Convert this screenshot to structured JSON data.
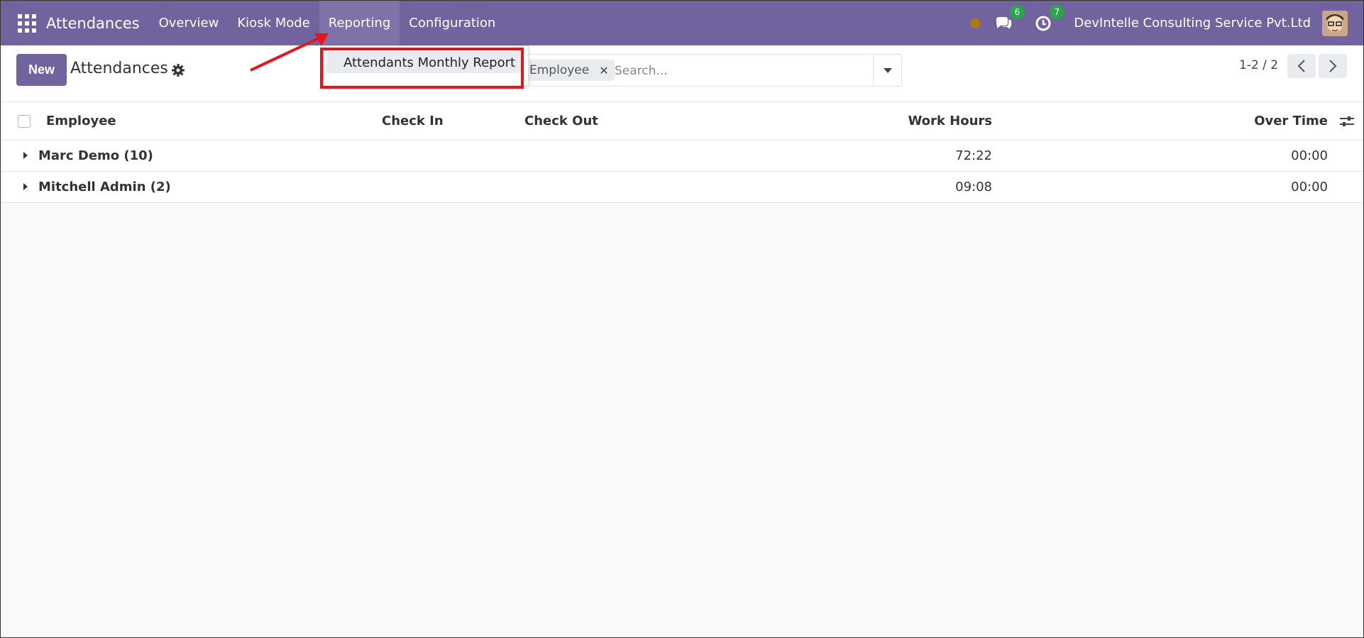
{
  "navbar": {
    "brand": "Attendances",
    "menu": [
      "Overview",
      "Kiosk Mode",
      "Reporting",
      "Configuration"
    ],
    "active_menu": "Reporting",
    "messages_count": "6",
    "activities_count": "7",
    "company": "DevIntelle Consulting Service Pvt.Ltd",
    "accent_color": "#71639e"
  },
  "control_panel": {
    "new_label": "New",
    "title": "Attendances",
    "search": {
      "facet_label": "Employee",
      "placeholder": "Search..."
    },
    "pager": "1-2 / 2"
  },
  "dropdown": {
    "item_label": "Attendants Monthly Report"
  },
  "table": {
    "columns": {
      "employee": "Employee",
      "check_in": "Check In",
      "check_out": "Check Out",
      "work_hours": "Work Hours",
      "over_time": "Over Time"
    },
    "groups": [
      {
        "name": "Marc Demo (10)",
        "work_hours": "72:22",
        "over_time": "00:00"
      },
      {
        "name": "Mitchell Admin (2)",
        "work_hours": "09:08",
        "over_time": "00:00"
      }
    ]
  }
}
